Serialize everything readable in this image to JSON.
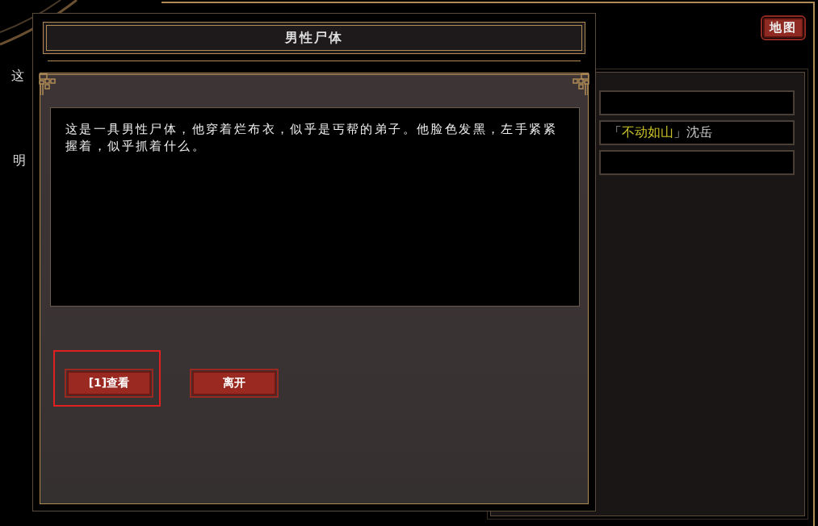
{
  "background": {
    "side_texts": [
      "这",
      "明"
    ],
    "map_button": {
      "label": "地图"
    },
    "list_rows": [
      {},
      {
        "prefix": "「",
        "highlight": "不动如山",
        "suffix": "」沈岳"
      },
      {}
    ]
  },
  "dialog": {
    "title": "男性尸体",
    "description": "这是一具男性尸体，他穿着烂布衣，似乎是丐帮的弟子。他脸色发黑，左手紧紧握着，似乎抓着什么。",
    "buttons": [
      {
        "label": "[1]查看",
        "selected": true
      },
      {
        "label": "离开",
        "selected": false
      }
    ]
  }
}
